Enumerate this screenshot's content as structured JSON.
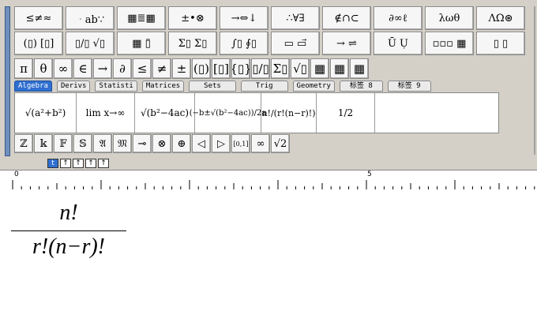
{
  "palette_row1": [
    "≤≠≈",
    "ᆞab∵",
    "▦≣▦",
    "±•⊗",
    "→⇔↓",
    "∴∀∃",
    "∉∩⊂",
    "∂∞ℓ",
    "λωθ",
    "ΛΩ⊛"
  ],
  "palette_row2": [
    "(▯) [▯]",
    "▯/▯ √▯",
    "▦ ▯̈",
    "Σ▯ Σ▯",
    "∫▯ ∮▯",
    "▭ ▭⃗",
    "→ ⇌",
    "Ū Ụ",
    "▫▫▫ ▦",
    "▯ ▯"
  ],
  "palette_row3": [
    "π",
    "θ",
    "∞",
    "∈",
    "→",
    "∂",
    "≤",
    "≠",
    "±",
    "(▯)",
    "[▯]",
    "{▯}",
    "▯/▯",
    "Σ▯",
    "√▯",
    "▦",
    "▦",
    "▦"
  ],
  "tabs": [
    "Algebra",
    "Derivs",
    "Statisti",
    "Matrices",
    "Sets",
    "Trig",
    "Geometry",
    "标签 8",
    "标签 9"
  ],
  "templates": [
    "√(a²+b²)",
    "lim x→∞",
    "√(b²−4ac)",
    "(−b±√(b²−4ac))/2a",
    "n!/(r!(n−r)!)",
    "1/2"
  ],
  "palette_row5": [
    "ℤ",
    "𝕜",
    "𝔽",
    "𝕊",
    "𝔄",
    "𝔐",
    "⊸",
    "⊗",
    "⊕",
    "◁",
    "▷",
    "[0,1]",
    "∞",
    "√2"
  ],
  "small_buttons": [
    "t",
    "↑",
    "↑",
    "↑",
    "↑"
  ],
  "ruler": {
    "labels": [
      "0",
      "5"
    ]
  },
  "equation": {
    "numerator": "n!",
    "denominator": "r!(n−r)!"
  }
}
